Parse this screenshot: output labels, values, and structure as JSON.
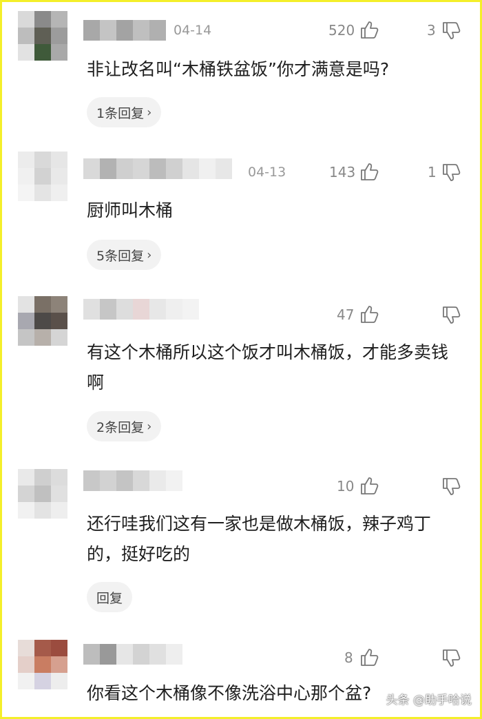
{
  "colors": {
    "frame": "#f4ef2a",
    "reply_bg": "#f2f2f2",
    "meta_text": "#999999"
  },
  "comments": [
    {
      "date": "04-14",
      "likes": "520",
      "dislikes": "3",
      "text": "非让改名叫“木桶铁盆饭”你才满意是吗?",
      "reply": "1条回复"
    },
    {
      "date": "04-13",
      "likes": "143",
      "dislikes": "1",
      "text": "厨师叫木桶",
      "reply": "5条回复"
    },
    {
      "date": "",
      "likes": "47",
      "dislikes": "",
      "text": "有这个木桶所以这个饭才叫木桶饭，才能多卖钱啊",
      "reply": "2条回复"
    },
    {
      "date": "",
      "likes": "10",
      "dislikes": "",
      "text": "还行哇我们这有一家也是做木桶饭，辣子鸡丁的，挺好吃的",
      "reply": "回复"
    },
    {
      "date": "",
      "likes": "8",
      "dislikes": "",
      "text": "你看这个木桶像不像洗浴中心那个盆?",
      "reply": ""
    }
  ],
  "icons": {
    "like": "thumbs-up-icon",
    "dislike": "thumbs-down-icon",
    "chevron": "chevron-right-icon"
  },
  "watermark": "头条 @助手哈说"
}
